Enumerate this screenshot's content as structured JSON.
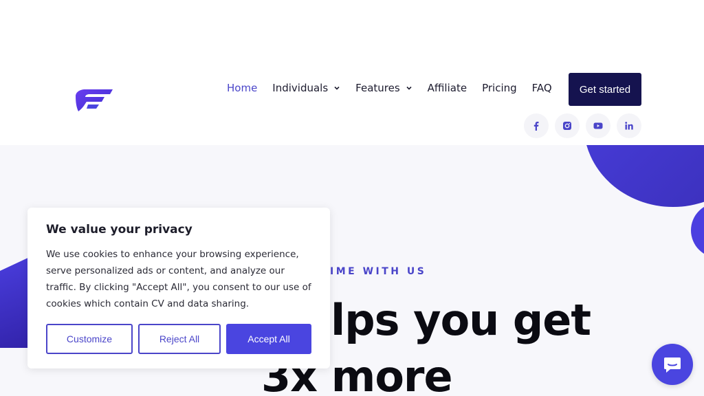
{
  "nav": {
    "items": [
      {
        "label": "Home",
        "active": true,
        "dropdown": false
      },
      {
        "label": "Individuals",
        "active": false,
        "dropdown": true
      },
      {
        "label": "Features",
        "active": false,
        "dropdown": true
      },
      {
        "label": "Affiliate",
        "active": false,
        "dropdown": false
      },
      {
        "label": "Pricing",
        "active": false,
        "dropdown": false
      },
      {
        "label": "FAQ",
        "active": false,
        "dropdown": false
      }
    ],
    "cta_label": "Get started"
  },
  "socials": [
    "facebook-icon",
    "instagram-icon",
    "youtube-icon",
    "linkedin-icon"
  ],
  "hero": {
    "eyebrow": "IME WITH US",
    "headline_line1": "elps you get",
    "headline_line2": "3x more"
  },
  "cookie": {
    "title": "We value your privacy",
    "body": "We use cookies to enhance your browsing experience, serve personalized ads or content, and analyze our traffic. By clicking \"Accept All\", you consent to our use of cookies which contain CV and data sharing.",
    "customize_label": "Customize",
    "reject_label": "Reject All",
    "accept_label": "Accept All"
  },
  "colors": {
    "accent": "#4a45c9",
    "accent_bright": "#4a45e0",
    "cta_bg": "#15134f",
    "hero_bg": "#f7f7fb"
  }
}
